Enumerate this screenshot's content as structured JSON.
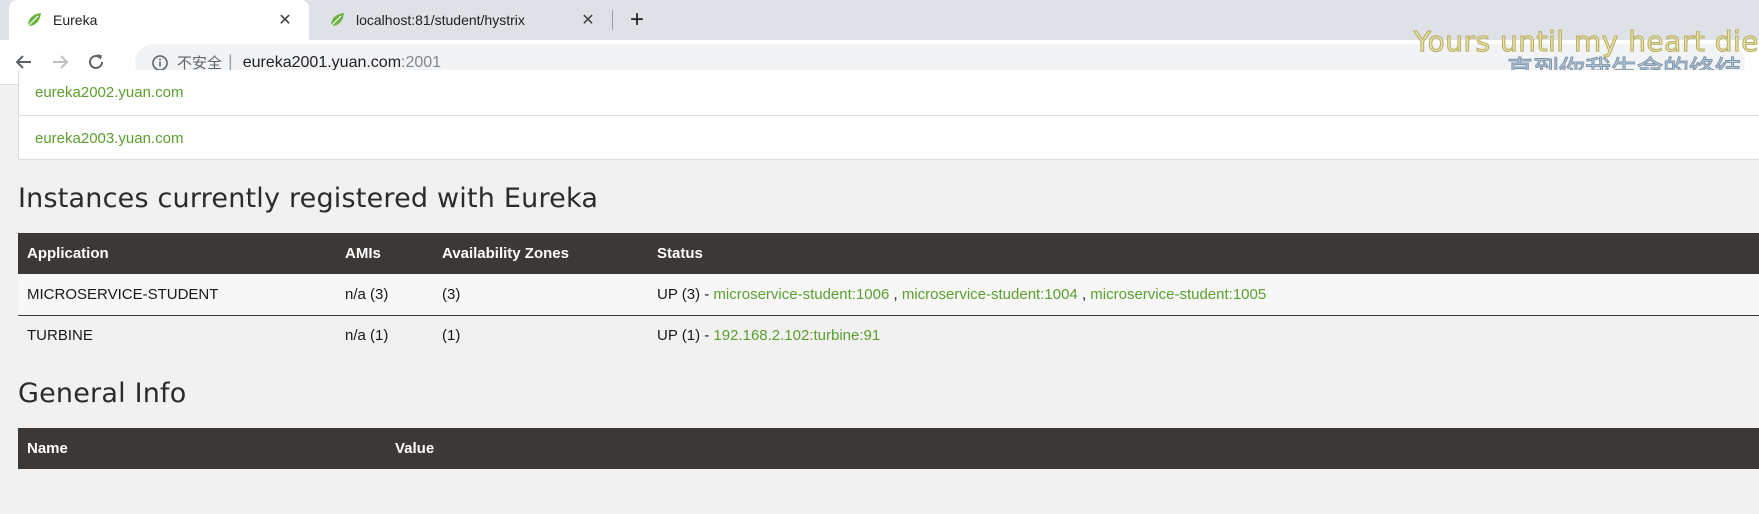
{
  "browser": {
    "tabs": [
      {
        "title": "Eureka",
        "active": true,
        "favicon": "spring-leaf-icon"
      },
      {
        "title": "localhost:81/student/hystrix",
        "active": false,
        "favicon": "spring-leaf-icon"
      }
    ],
    "new_tab": "+",
    "address": {
      "security_label": "不安全",
      "separator": "|",
      "host": "eureka2001.yuan.com",
      "port": ":2001"
    }
  },
  "overlay": {
    "line1": "Yours until my heart die",
    "line2": "直到你我生命的终结"
  },
  "replicas": [
    "eureka2002.yuan.com",
    "eureka2003.yuan.com"
  ],
  "instances": {
    "heading": "Instances currently registered with Eureka",
    "columns": [
      "Application",
      "AMIs",
      "Availability Zones",
      "Status"
    ],
    "rows": [
      {
        "application": "MICROSERVICE-STUDENT",
        "amis": "n/a (3)",
        "zones": "(3)",
        "status": "UP (3) -",
        "links": [
          "microservice-student:1006",
          "microservice-student:1004",
          "microservice-student:1005"
        ],
        "link_separator": ","
      },
      {
        "application": "TURBINE",
        "amis": "n/a (1)",
        "zones": "(1)",
        "status": "UP (1) -",
        "links": [
          "192.168.2.102:turbine:91"
        ]
      }
    ]
  },
  "general": {
    "heading": "General Info",
    "columns": [
      "Name",
      "Value"
    ]
  },
  "colors": {
    "link": "#5ba02e",
    "table_header": "#3b3835",
    "page_bg": "#f1f1f1"
  }
}
